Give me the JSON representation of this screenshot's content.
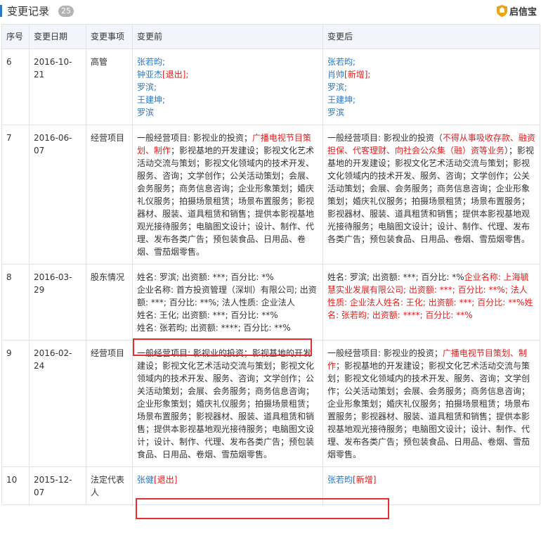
{
  "header": {
    "title": "变更记录",
    "count": "25",
    "logo_text": "启信宝"
  },
  "columns": [
    "序号",
    "变更日期",
    "变更事项",
    "变更前",
    "变更后"
  ],
  "rows": [
    {
      "no": "6",
      "date": "2016-10-21",
      "item": "高管",
      "before": [
        {
          "t": "张若昀;",
          "c": "blue"
        },
        {
          "t": "钟亚杰",
          "c": "blue",
          "tag": "[退出];",
          "tagc": "red"
        },
        {
          "t": "罗滨;",
          "c": "blue"
        },
        {
          "t": "王建坤;",
          "c": "blue"
        },
        {
          "t": "罗滨",
          "c": "blue"
        }
      ],
      "after": [
        {
          "t": "张若昀;",
          "c": "blue"
        },
        {
          "t": "肖帅",
          "c": "blue",
          "tag": "[新增];",
          "tagc": "red"
        },
        {
          "t": "罗滨;",
          "c": "blue"
        },
        {
          "t": "王建坤;",
          "c": "blue"
        },
        {
          "t": "罗滨",
          "c": "blue"
        }
      ]
    },
    {
      "no": "7",
      "date": "2016-06-07",
      "item": "经营项目",
      "before": [
        {
          "t": "一般经营项目: 影视业的投资；",
          "c": "",
          "tag": "广播电视节目策划、制作",
          "tagc": "red",
          "rest": "；影视基地的开发建设；影视文化艺术活动交流与策划；影视文化领域内的技术开发、服务、咨询；文学创作；公关活动策划；会展、会务服务；商务信息咨询；企业形象策划；婚庆礼仪服务；拍摄场景租赁；场景布置服务；影视器材、服装、道具租赁和销售；提供本影视基地观光接待服务；电脑图文设计；设计、制作、代理、发布各类广告；预包装食品、日用品、卷烟、雪茄烟零售。"
        }
      ],
      "after": [
        {
          "t": "一般经营项目: 影视业的投资（",
          "c": "",
          "tag": "不得从事吸收存款、融资担保、代客理财、向社会公众集（融）资等业务",
          "tagc": "red",
          "rest": "）；影视基地的开发建设；影视文化艺术活动交流与策划；影视文化领域内的技术开发、服务、咨询；文学创作；公关活动策划；会展、会务服务；商务信息咨询；企业形象策划；婚庆礼仪服务；拍摄场景租赁；场景布置服务；影视器材、服装、道具租赁和销售；提供本影视基地观光接待服务；电脑图文设计；设计、制作、代理、发布各类广告；预包装食品、日用品、卷烟、雪茄烟零售。"
        }
      ]
    },
    {
      "no": "8",
      "date": "2016-03-29",
      "item": "股东情况",
      "before": [
        {
          "t": "姓名: 罗滨; 出资额: ***; 百分比: *%",
          "c": ""
        },
        {
          "t": "企业名称: 首方投资管理（深圳）有限公司; 出资额: ***; 百分比: **%; 法人性质: 企业法人",
          "c": ""
        },
        {
          "t": "姓名: 王化; 出资额: ***; 百分比: **%",
          "c": ""
        },
        {
          "t": "姓名: 张若昀; 出资额: ****; 百分比: **%",
          "c": ""
        }
      ],
      "after": [
        {
          "t": "姓名: 罗滨; 出资额: ***; 百分比: *%",
          "c": "",
          "tag": "企业名称: 上海毓慧实业发展有限公司; 出资额: ***; 百分比: **%; 法人性质: 企业法人姓名: 王化; 出资额: ***; 百分比: **%姓名: 张若昀; 出资额: ****; 百分比: **%",
          "tagc": "red"
        }
      ]
    },
    {
      "no": "9",
      "date": "2016-02-24",
      "item": "经营项目",
      "before": [
        {
          "t": "一般经营项目: 影视业的投资；影视基地的开发建设；影视文化艺术活动交流与策划；影视文化领域内的技术开发、服务、咨询；文学创作；公关活动策划；会展、会务服务；商务信息咨询；企业形象策划；婚庆礼仪服务；拍摄场景租赁；场景布置服务；影视器材、服装、道具租赁和销售；提供本影视基地观光接待服务；电脑图文设计；设计、制作、代理、发布各类广告；预包装食品、日用品、卷烟、雪茄烟零售。",
          "c": ""
        }
      ],
      "after": [
        {
          "t": "一般经营项目: 影视业的投资；",
          "c": "",
          "tag": "广播电视节目策划、制作",
          "tagc": "red",
          "rest": "；影视基地的开发建设；影视文化艺术活动交流与策划；影视文化领域内的技术开发、服务、咨询；文学创作；公关活动策划；会展、会务服务；商务信息咨询；企业形象策划；婚庆礼仪服务；拍摄场景租赁；场景布置服务；影视器材、服装、道具租赁和销售；提供本影视基地观光接待服务；电脑图文设计；设计、制作、代理、发布各类广告；预包装食品、日用品、卷烟、雪茄烟零售。"
        }
      ]
    },
    {
      "no": "10",
      "date": "2015-12-07",
      "item": "法定代表人",
      "before": [
        {
          "t": "张健",
          "c": "blue",
          "tag": "[退出]",
          "tagc": "red"
        }
      ],
      "after": [
        {
          "t": "张若昀",
          "c": "blue",
          "tag": "[新增]",
          "tagc": "red"
        }
      ]
    }
  ]
}
